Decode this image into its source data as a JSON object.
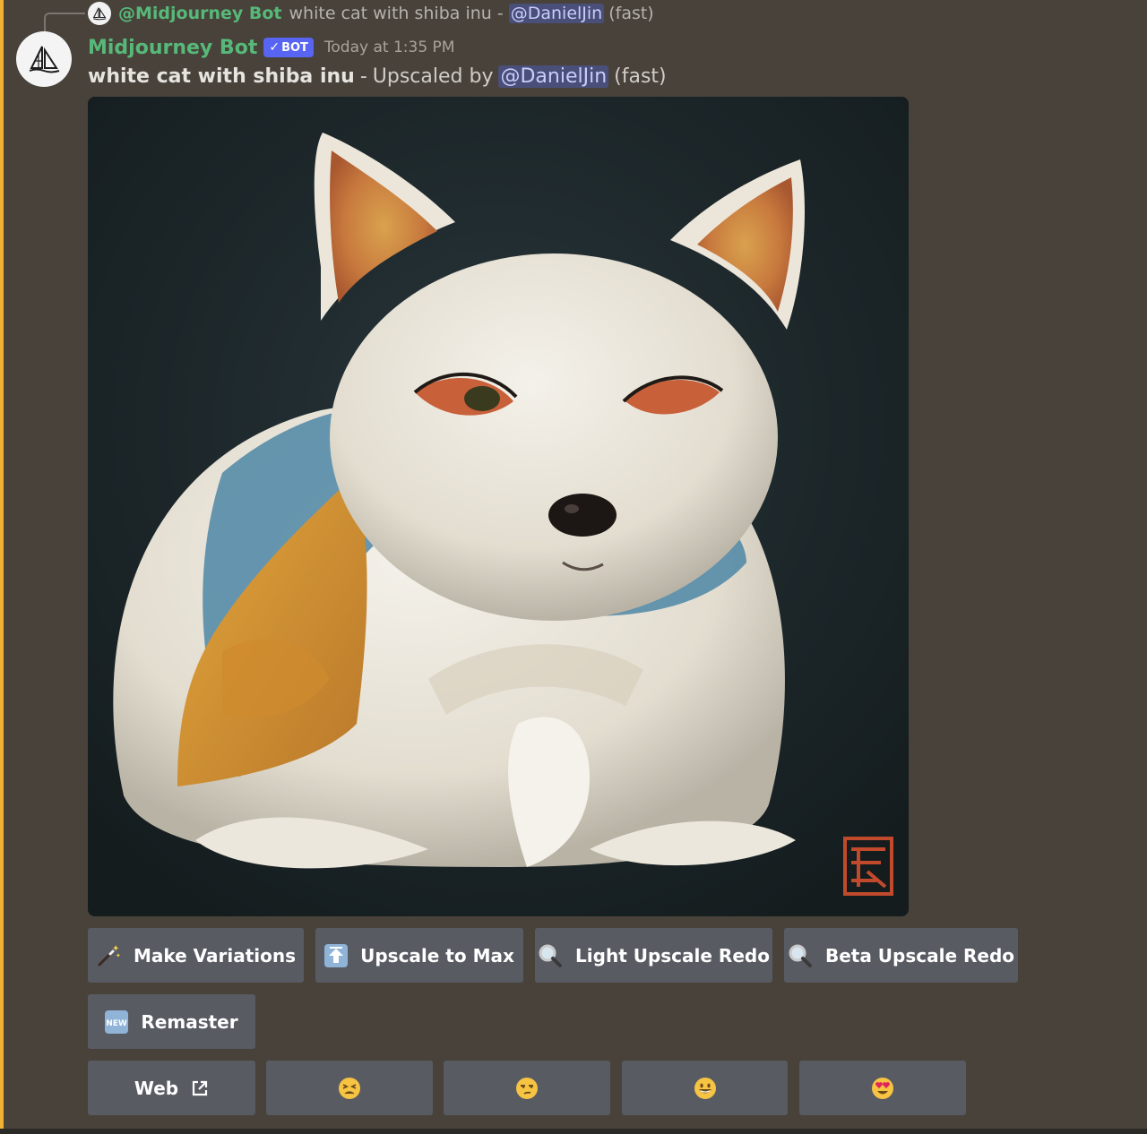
{
  "reply": {
    "author": "@Midjourney Bot",
    "text": "white cat with shiba inu -",
    "mention": "@DanielJin",
    "suffix": "(fast)"
  },
  "message": {
    "author": "Midjourney Bot",
    "badge": "BOT",
    "timestamp": "Today at 1:35 PM",
    "prompt": "white cat with shiba inu",
    "separator": "-",
    "upscaled_by": "Upscaled by",
    "mention": "@DanielJin",
    "speed": "(fast)"
  },
  "buttons": {
    "make_variations": "Make Variations",
    "upscale_to_max": "Upscale to Max",
    "light_upscale_redo": "Light Upscale Redo",
    "beta_upscale_redo": "Beta Upscale Redo",
    "remaster": "Remaster",
    "new_badge": "NEW",
    "web": "Web"
  },
  "icons": {
    "make_variations": "magic-wand-icon",
    "upscale_to_max": "up-arrow-icon",
    "light_upscale_redo": "magnifier-icon",
    "beta_upscale_redo": "magnifier-icon",
    "remaster": "new-badge-icon",
    "web": "external-link-icon",
    "reactions": [
      "tired-face-icon",
      "unamused-face-icon",
      "grinning-face-icon",
      "heart-eyes-face-icon"
    ]
  },
  "colors": {
    "background": "#48423a",
    "accent_bar": "#f0b232",
    "author": "#57b979",
    "bot_badge": "#5865f2",
    "mention_bg": "#4a4f7a",
    "button_bg": "#585b62"
  }
}
